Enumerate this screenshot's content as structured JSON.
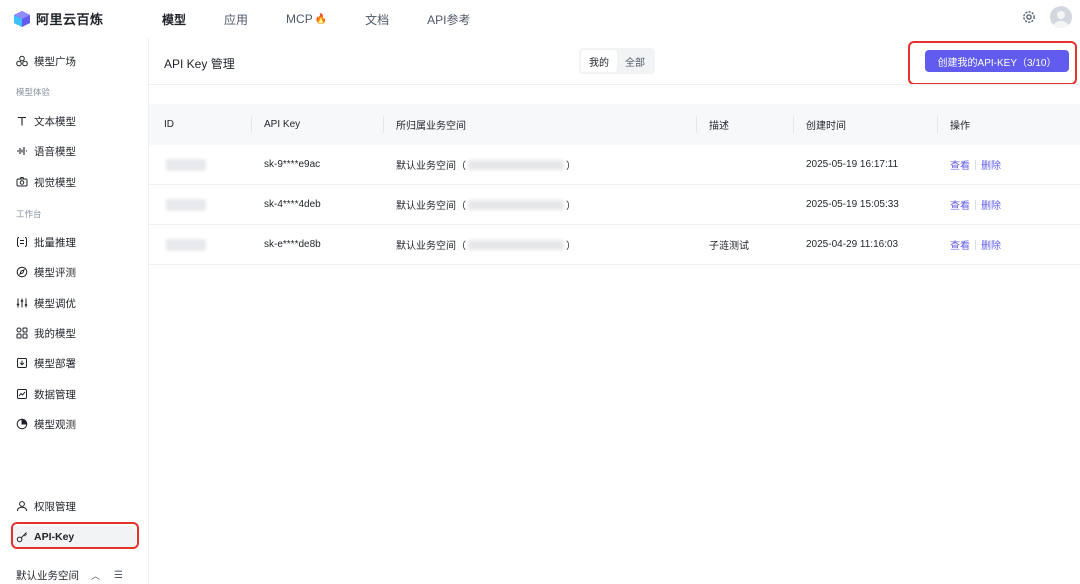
{
  "brand": {
    "name": "阿里云百炼"
  },
  "nav": {
    "items": [
      {
        "label": "模型",
        "active": true
      },
      {
        "label": "应用",
        "active": false
      },
      {
        "label": "MCP",
        "active": false,
        "badge": "🔥"
      },
      {
        "label": "文档",
        "active": false
      },
      {
        "label": "API参考",
        "active": false
      }
    ]
  },
  "sidebar": {
    "model_square": "模型广场",
    "group_experience": "模型体验",
    "text_model": "文本模型",
    "voice_model": "语音模型",
    "vision_model": "视觉模型",
    "group_workbench": "工作台",
    "batch_inference": "批量推理",
    "model_eval": "模型评测",
    "model_tuning": "模型调优",
    "my_models": "我的模型",
    "model_deploy": "模型部署",
    "data_mgmt": "数据管理",
    "model_observe": "模型观测",
    "permission": "权限管理",
    "api_key": "API-Key",
    "workspace": "默认业务空间"
  },
  "page": {
    "title": "API Key 管理",
    "seg_mine": "我的",
    "seg_all": "全部",
    "create_button": "创建我的API-KEY（3/10）"
  },
  "table": {
    "headers": {
      "id": "ID",
      "api_key": "API Key",
      "workspace": "所归属业务空间",
      "desc": "描述",
      "created": "创建时间",
      "ops": "操作"
    },
    "rows": [
      {
        "api_key": "sk-9****e9ac",
        "ws_prefix": "默认业务空间（",
        "ws_suffix": "）",
        "desc": "",
        "created": "2025-05-19 16:17:11",
        "view": "查看",
        "delete": "删除"
      },
      {
        "api_key": "sk-4****4deb",
        "ws_prefix": "默认业务空间（",
        "ws_suffix": "）",
        "desc": "",
        "created": "2025-05-19 15:05:33",
        "view": "查看",
        "delete": "删除"
      },
      {
        "api_key": "sk-e****de8b",
        "ws_prefix": "默认业务空间（",
        "ws_suffix": "）",
        "desc": "子涟测试",
        "created": "2025-04-29 11:16:03",
        "view": "查看",
        "delete": "删除"
      }
    ]
  },
  "colors": {
    "accent": "#615ced",
    "highlight_border": "#e5322d"
  }
}
